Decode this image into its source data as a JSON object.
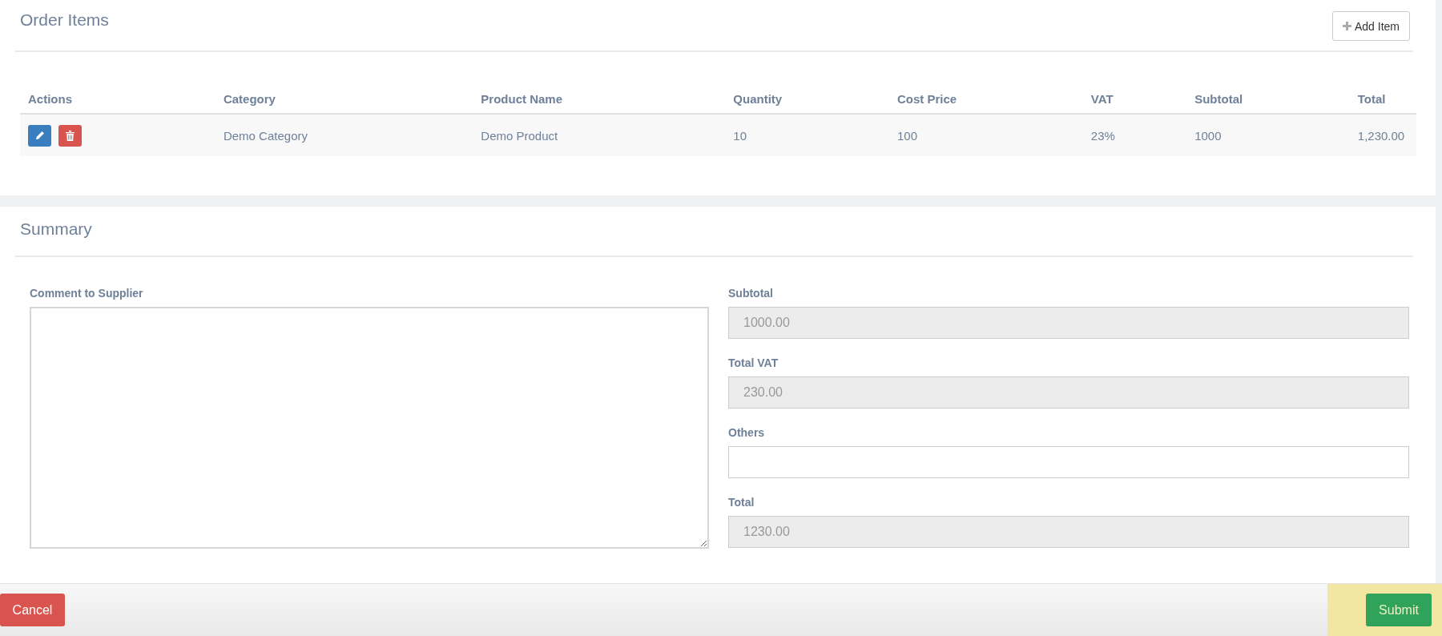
{
  "order_items": {
    "title": "Order Items",
    "add_button": "Add Item",
    "table": {
      "columns": [
        "Actions",
        "Category",
        "Product Name",
        "Quantity",
        "Cost Price",
        "VAT",
        "Subtotal",
        "Total"
      ],
      "rows": [
        {
          "category": "Demo Category",
          "product_name": "Demo Product",
          "quantity": "10",
          "cost_price": "100",
          "vat": "23%",
          "subtotal": "1000",
          "total": "1,230.00"
        }
      ]
    }
  },
  "summary": {
    "title": "Summary",
    "comment": {
      "label": "Comment to Supplier"
    },
    "fields": [
      {
        "label": "Subtotal",
        "value": "1000.00",
        "disabled": true
      },
      {
        "label": "Total VAT",
        "value": "230.00",
        "disabled": true
      },
      {
        "label": "Others",
        "disabled": false
      },
      {
        "label": "Total",
        "value": "1230.00",
        "disabled": true
      }
    ]
  },
  "footer": {
    "cancel": "Cancel",
    "submit": "Submit"
  }
}
